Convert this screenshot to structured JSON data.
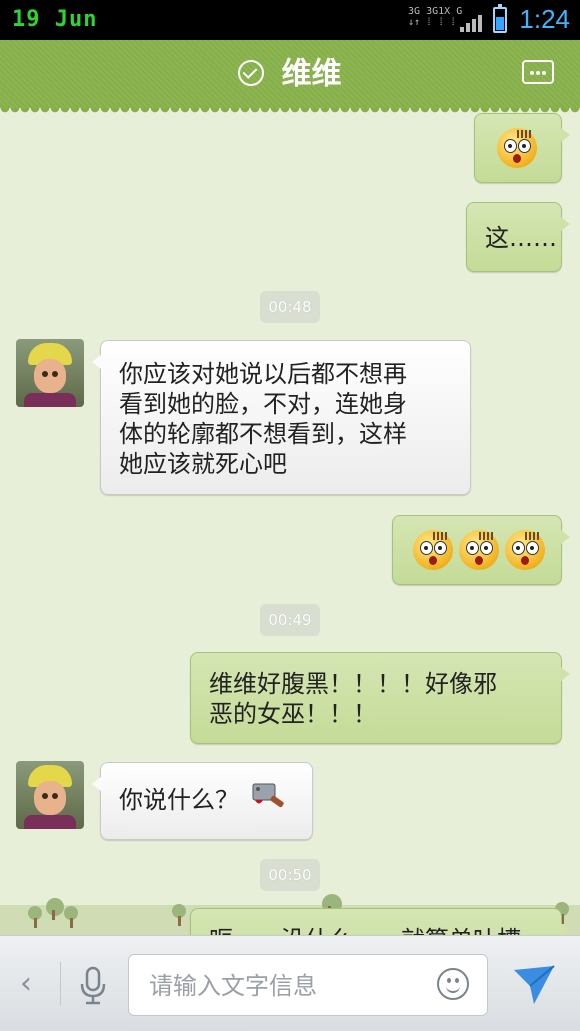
{
  "status_bar": {
    "date": "19 Jun",
    "network_labels": [
      "3G",
      "3G",
      "1X",
      "G"
    ],
    "time": "1:24"
  },
  "header": {
    "title": "维维",
    "title_icon": "check-circle-icon",
    "menu_icon": "more-options-icon"
  },
  "messages": [
    {
      "id": "m1",
      "direction": "out",
      "type": "emoji",
      "emoji_count": 1
    },
    {
      "id": "m2",
      "direction": "out",
      "type": "text",
      "text": "这……"
    },
    {
      "id": "t1",
      "type": "timestamp",
      "text": "00:48"
    },
    {
      "id": "m3",
      "direction": "in",
      "type": "text",
      "text": "你应该对她说以后都不想再\n看到她的脸，不对，连她身\n体的轮廓都不想看到，这样\n她应该就死心吧"
    },
    {
      "id": "m4",
      "direction": "out",
      "type": "emoji",
      "emoji_count": 3
    },
    {
      "id": "t2",
      "type": "timestamp",
      "text": "00:49"
    },
    {
      "id": "m5",
      "direction": "out",
      "type": "text",
      "text": "维维好腹黑！！！！好像邪\n恶的女巫！！！"
    },
    {
      "id": "m6",
      "direction": "in",
      "type": "text",
      "text": "你说什么？",
      "attachment_icon": "cleaver-icon"
    },
    {
      "id": "t3",
      "type": "timestamp",
      "text": "00:50"
    },
    {
      "id": "m7",
      "direction": "out",
      "type": "text",
      "text": "呃……没什么……就算单吐槽"
    }
  ],
  "input_bar": {
    "placeholder": "请输入文字信息",
    "value": "",
    "back_icon": "chevron-left-icon",
    "mic_icon": "microphone-icon",
    "emoji_icon": "smiley-icon",
    "send_icon": "send-icon"
  },
  "colors": {
    "header_green": "#8db552",
    "chat_background": "#e7efd9",
    "outgoing_bubble": "#cfe2a9",
    "incoming_bubble": "#ffffff",
    "time_blue": "#41b4ff"
  }
}
